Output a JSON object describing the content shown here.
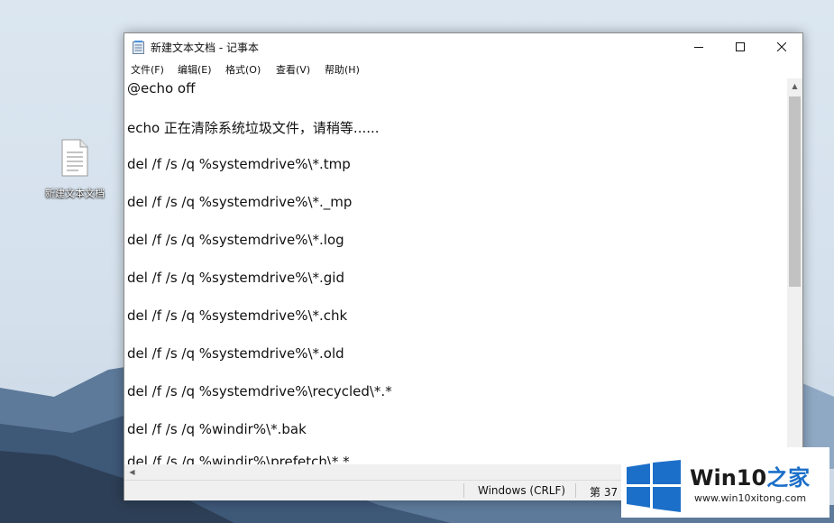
{
  "desktop": {
    "icon_label": "新建文本文档"
  },
  "window": {
    "title": "新建文本文档 - 记事本",
    "menu": [
      "文件(F)",
      "编辑(E)",
      "格式(O)",
      "查看(V)",
      "帮助(H)"
    ],
    "lines": [
      "@echo off",
      "echo 正在清除系统垃圾文件，请稍等......",
      "del /f /s /q %systemdrive%\\*.tmp",
      "del /f /s /q %systemdrive%\\*._mp",
      "del /f /s /q %systemdrive%\\*.log",
      "del /f /s /q %systemdrive%\\*.gid",
      "del /f /s /q %systemdrive%\\*.chk",
      "del /f /s /q %systemdrive%\\*.old",
      "del /f /s /q %systemdrive%\\recycled\\*.*",
      "del /f /s /q %windir%\\*.bak",
      "del /f /s /q %windir%\\prefetch\\*.*"
    ],
    "status": {
      "encoding_eol": "Windows (CRLF)",
      "position": "第 37"
    }
  },
  "watermark": {
    "brand": "Win10",
    "brand_suffix": "之家",
    "url": "www.win10xitong.com"
  },
  "colors": {
    "accent": "#1c6fc9",
    "window_bg": "#ffffff",
    "chrome_bg": "#f0f0f0"
  }
}
